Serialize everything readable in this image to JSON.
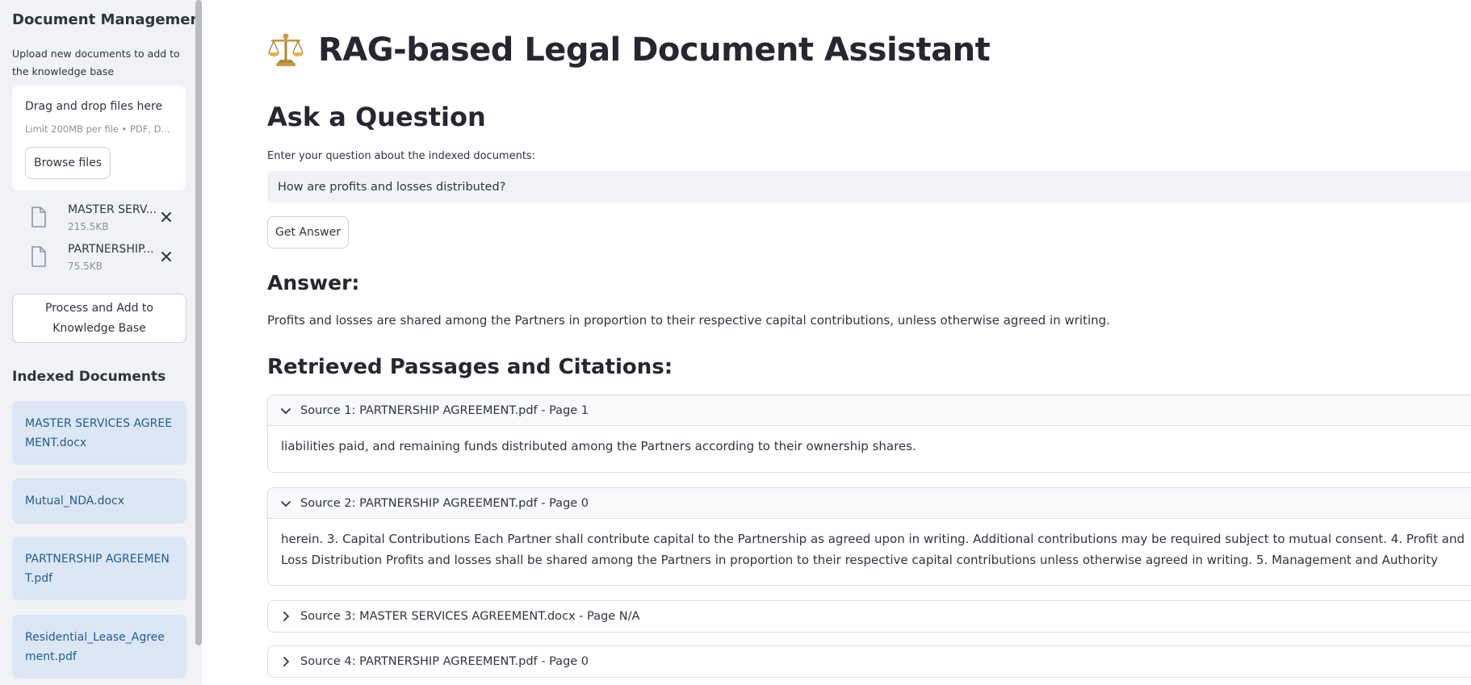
{
  "sidebar": {
    "title": "Document Management",
    "description": "Upload new documents to add to the knowledge base",
    "uploader": {
      "drop_text": "Drag and drop files here",
      "limit_text": "Limit 200MB per file • PDF, D...",
      "browse_label": "Browse files"
    },
    "uploaded_files": [
      {
        "name": "MASTER SERV...",
        "size": "215.5KB"
      },
      {
        "name": "PARTNERSHIP...",
        "size": "75.5KB"
      }
    ],
    "process_button": "Process and Add to Knowledge Base",
    "indexed_title": "Indexed Documents",
    "indexed_docs": [
      "MASTER SERVICES AGREEMENT.docx",
      "Mutual_NDA.docx",
      "PARTNERSHIP AGREEMENT.pdf",
      "Residential_Lease_Agreement.pdf"
    ]
  },
  "main": {
    "title": "RAG-based Legal Document Assistant",
    "title_icon": "balance-scale-icon",
    "ask_heading": "Ask a Question",
    "question_label": "Enter your question about the indexed documents:",
    "question_value": "How are profits and losses distributed?",
    "get_answer_label": "Get Answer",
    "answer_heading": "Answer:",
    "answer_text": "Profits and losses are shared among the Partners in proportion to their respective capital contributions, unless otherwise agreed in writing.",
    "passages_heading": "Retrieved Passages and Citations:",
    "sources": [
      {
        "title": "Source 1: PARTNERSHIP AGREEMENT.pdf - Page 1",
        "expanded": true,
        "content": "liabilities paid, and remaining funds distributed among the Partners according to their ownership shares."
      },
      {
        "title": "Source 2: PARTNERSHIP AGREEMENT.pdf - Page 0",
        "expanded": true,
        "content": "herein. 3. Capital Contributions Each Partner shall contribute capital to the Partnership as agreed upon in writing. Additional contributions may be required subject to mutual consent. 4. Profit and Loss Distribution Profits and losses shall be shared among the Partners in proportion to their respective capital contributions unless otherwise agreed in writing. 5. Management and Authority"
      },
      {
        "title": "Source 3: MASTER SERVICES AGREEMENT.docx - Page N/A",
        "expanded": false,
        "content": ""
      },
      {
        "title": "Source 4: PARTNERSHIP AGREEMENT.pdf - Page 0",
        "expanded": false,
        "content": ""
      }
    ]
  },
  "colors": {
    "sidebar_bg": "#f0f2f6",
    "doc_card_bg": "#dce6f4",
    "doc_link": "#1f5c8f",
    "text": "#31333f"
  }
}
